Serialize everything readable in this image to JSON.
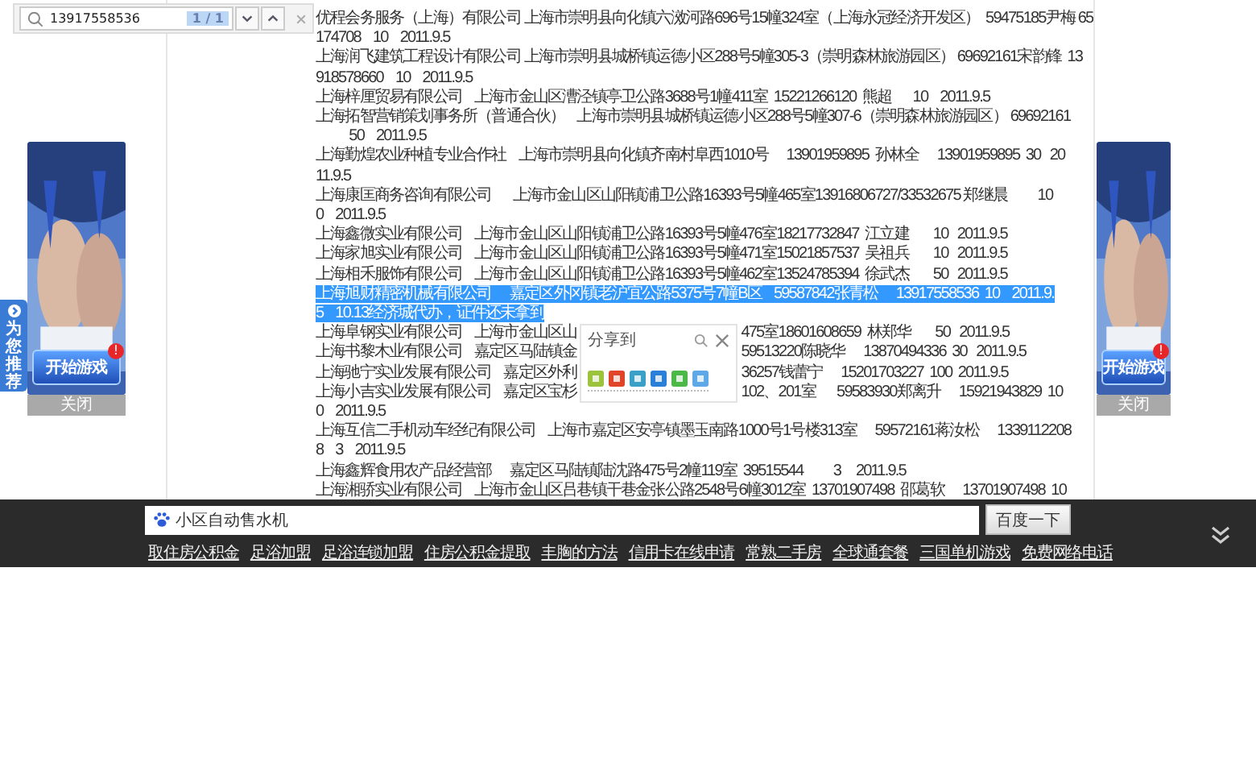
{
  "find_bar": {
    "query": "13917558536",
    "match_count": "1 / 1"
  },
  "recommend_tab": {
    "label": "为您推荐"
  },
  "ads": [
    {
      "button": "开始游戏",
      "badge": "!",
      "close": "关闭"
    },
    {
      "button": "开始游戏",
      "badge": "!",
      "close": "关闭"
    }
  ],
  "records": [
    {
      "text": "优程会务服务（上海）有限公司 上海市崇明县向化镇六滧河路696号15幢324室（上海永冠经济开发区）  59475185尹梅 65\n174708    10    2011.9.5",
      "selected": false
    },
    {
      "text": "上海润飞建筑工程设计有限公司 上海市崇明县城桥镇运德小区288号5幢305-3（崇明森林旅游园区） 69692161宋韵锋  13\n918578660    10    2011.9.5",
      "selected": false
    },
    {
      "text": "上海梓厘贸易有限公司    上海市金山区漕泾镇亭卫公路3688号1幢411室  15221266120  熊超       10    2011.9.5",
      "selected": false
    },
    {
      "text": "上海拓智营销策划事务所（普通合伙）    上海市崇明县城桥镇运德小区288号5幢307-6（崇明森林旅游园区） 69692161\n           50    2011.9.5",
      "selected": false
    },
    {
      "text": "上海勤煌农业种植专业合作社    上海市崇明县向化镇齐南村阜西1010号      13901959895  孙林全      13901959895  30   20\n11.9.5",
      "selected": false
    },
    {
      "text": "上海康匡商务咨询有限公司       上海市金山区山阳镇浦卫公路16393号5幢465室13916806727/33532675 郑继晨          10\n0    2011.9.5",
      "selected": false
    },
    {
      "text": "上海鑫微实业有限公司    上海市金山区山阳镇浦卫公路16393号5幢476室18217732847  江立建        10   2011.9.5",
      "selected": false
    },
    {
      "text": "上海家旭实业有限公司    上海市金山区山阳镇浦卫公路16393号5幢471室15021857537  吴祖兵        10   2011.9.5",
      "selected": false
    },
    {
      "text": "上海相禾服饰有限公司    上海市金山区山阳镇浦卫公路16393号5幢462室13524785394  徐武杰        50   2011.9.5",
      "selected": false
    },
    {
      "text": "上海旭财精密机械有限公司      嘉定区外冈镇老沪宜公路5375号7幢B区    59587842张青松      13917558536  10    2011.9.\n5    10.13经济城代办，证件还未拿到",
      "selected": true
    },
    {
      "left": "上海阜钢实业有限公司    上海市金山区山",
      "right": "475室18601608659  林郑华        50   2011.9.5",
      "selected": false
    },
    {
      "left": "上海书黎木业有限公司    嘉定区马陆镇金",
      "right": "59513220陈晓华      13870494336  30   2011.9.5",
      "selected": false
    },
    {
      "left": "上海驰宁实业发展有限公司    嘉定区外利",
      "right": "36257钱蕾宁      15201703227  100  2011.9.5",
      "selected": false
    },
    {
      "left": "上海小吉实业发展有限公司    嘉定区宝杉",
      "right": "102、201室       59583930郑离升      15921943829  10",
      "continuation": "0    2011.9.5",
      "selected": false
    },
    {
      "text": "上海互信二手机动车经纪有限公司    上海市嘉定区安亭镇墨玉南路1000号1号楼313室      59572161蒋汝松      1339112208\n8    3    2011.9.5",
      "selected": false
    },
    {
      "text": "上海鑫辉食用农产品经营部      嘉定区马陆镇陆沈路475号2幢119室  39515544          3     2011.9.5",
      "selected": false
    },
    {
      "text": "上海湘骄实业有限公司    上海市金山区吕巷镇干巷金张公路2548号6幢3012室  13701907498  邵葛软      13701907498  10",
      "selected": false
    }
  ],
  "share_popup": {
    "title": "分享到"
  },
  "search_bar": {
    "value": "小区自动售水机",
    "button": "百度一下",
    "links": [
      "取住房公积金",
      "足浴加盟",
      "足浴连锁加盟",
      "住房公积金提取",
      "丰胸的方法",
      "信用卡在线申请",
      "常熟二手房",
      "全球通套餐",
      "三国单机游戏",
      "免费网络电话"
    ]
  }
}
